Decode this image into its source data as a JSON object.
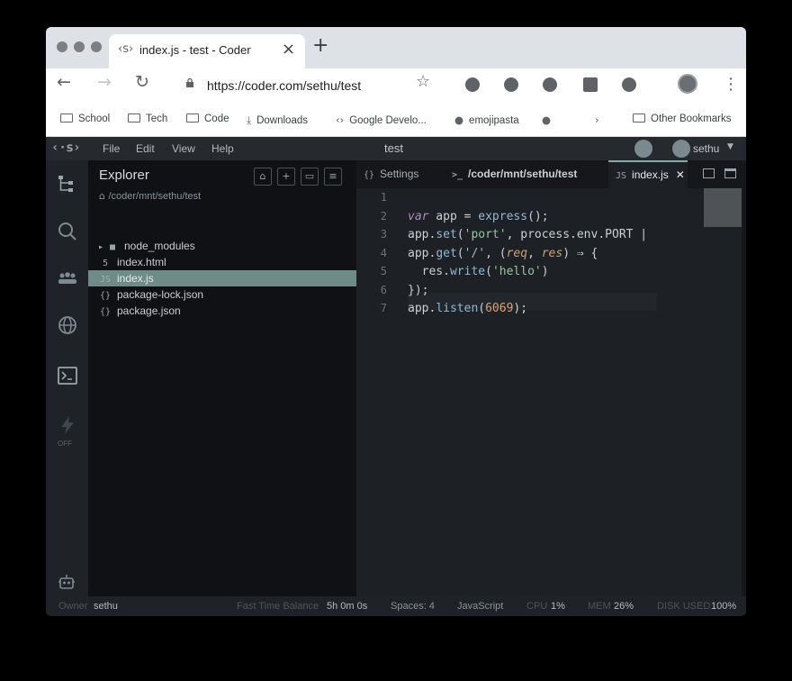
{
  "browser": {
    "tab_title": "index.js - test - Coder",
    "url": "https://coder.com/sethu/test",
    "bookmarks": [
      "School",
      "Tech",
      "Code",
      "Downloads",
      "Google Develo...",
      "emojipasta",
      "Other Bookmarks"
    ]
  },
  "app": {
    "menu": [
      "File",
      "Edit",
      "View",
      "Help"
    ],
    "title": "test",
    "user": "sethu"
  },
  "explorer": {
    "title": "Explorer",
    "path": "/coder/mnt/sethu/test",
    "items": [
      {
        "label": "node_modules",
        "icon": "folder",
        "selected": false
      },
      {
        "label": "index.html",
        "icon": "html5",
        "selected": false
      },
      {
        "label": "index.js",
        "icon": "js",
        "selected": true
      },
      {
        "label": "package-lock.json",
        "icon": "{}",
        "selected": false
      },
      {
        "label": "package.json",
        "icon": "{}",
        "selected": false
      }
    ]
  },
  "editor": {
    "tabs": [
      {
        "label": "Settings",
        "icon": "{}"
      },
      {
        "label": "/coder/mnt/sethu/test",
        "icon": ">_"
      },
      {
        "label": "index.js",
        "icon": "JS",
        "active": true
      }
    ],
    "line_numbers": [
      "1",
      "2",
      "3",
      "4",
      "5",
      "6",
      "7"
    ],
    "code_lines": [
      "",
      "var app = express();",
      "app.set('port', process.env.PORT |",
      "app.get('/', (req, res) ⇒ {",
      "  res.write('hello')",
      "});",
      "app.listen(6069);"
    ]
  },
  "activity": {
    "labels": [
      "OFF"
    ]
  },
  "status": {
    "owner_label": "Owner",
    "owner": "sethu",
    "balance_label": "Fast Time Balance",
    "balance": "5h 0m 0s",
    "spaces": "Spaces: 4",
    "language": "JavaScript",
    "cpu_label": "CPU",
    "cpu": "1%",
    "mem_label": "MEM",
    "mem": "26%",
    "disk_label": "DISK USED",
    "disk": "100%"
  },
  "icons": {
    "tab_favicon": "coder-logo-icon",
    "activity": [
      "explorer-icon",
      "search-icon",
      "team-icon",
      "globe-icon",
      "terminal-icon",
      "bolt-icon",
      "robot-icon"
    ]
  },
  "colors": {
    "accent": "#85aaa7",
    "selection": "#6e8b88",
    "background": "#1d2024",
    "sidebar": "#0f1114"
  }
}
